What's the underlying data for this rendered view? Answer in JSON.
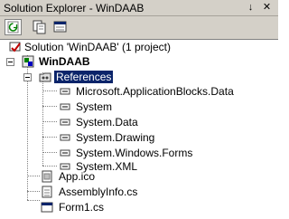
{
  "window": {
    "title": "Solution Explorer - WinDAAB",
    "pin_glyph": "↓",
    "close_glyph": "✕"
  },
  "toolbar": {
    "buttons": [
      {
        "name": "refresh-button"
      },
      {
        "name": "show-all-files-button"
      },
      {
        "name": "properties-button"
      }
    ]
  },
  "tree": {
    "solution": "Solution 'WinDAAB' (1 project)",
    "project": "WinDAAB",
    "references_folder": "References",
    "references": [
      "Microsoft.ApplicationBlocks.Data",
      "System",
      "System.Data",
      "System.Drawing",
      "System.Windows.Forms",
      "System.XML"
    ],
    "files": [
      "App.ico",
      "AssemblyInfo.cs",
      "Form1.cs"
    ]
  },
  "colors": {
    "selection": "#0a246a",
    "chrome": "#d4d0c8"
  }
}
